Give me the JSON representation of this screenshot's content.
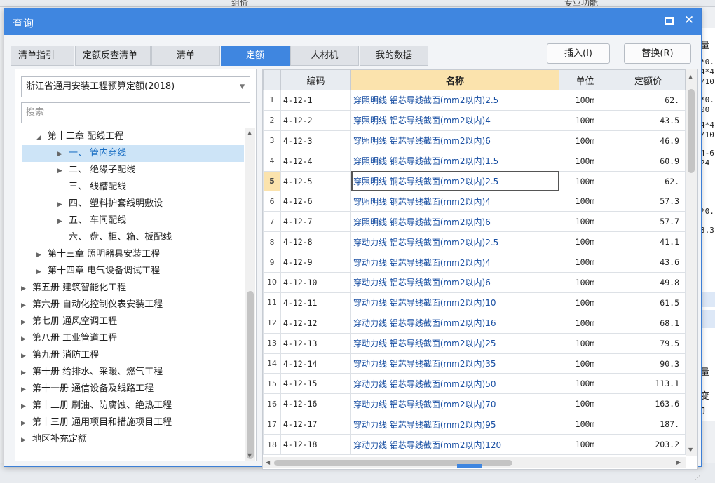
{
  "background": {
    "col_left": "组价",
    "col_right": "专业功能",
    "right_fragments": [
      "量",
      "*0.",
      "4*4",
      "/10",
      "*0.",
      "00",
      "4*4",
      "/10",
      "4-6",
      "24",
      "*0.",
      "3.3",
      "量",
      "变",
      "J"
    ]
  },
  "dialog": {
    "title": "查询",
    "tabs": [
      {
        "label": "清单指引"
      },
      {
        "label": "定额反查清单"
      },
      {
        "label": "清单"
      },
      {
        "label": "定额"
      },
      {
        "label": "人材机"
      },
      {
        "label": "我的数据"
      }
    ],
    "insert_button": "插入(I)",
    "replace_button": "替换(R)"
  },
  "left_panel": {
    "quota_select": "浙江省通用安装工程预算定额(2018)",
    "search_placeholder": "搜索",
    "tree": [
      {
        "label": "第十二章 配线工程"
      },
      {
        "label": "一、 管内穿线"
      },
      {
        "label": "二、 绝缘子配线"
      },
      {
        "label": "三、 线槽配线"
      },
      {
        "label": "四、 塑料护套线明敷设"
      },
      {
        "label": "五、 车间配线"
      },
      {
        "label": "六、 盘、柜、箱、板配线"
      },
      {
        "label": "第十三章 照明器具安装工程"
      },
      {
        "label": "第十四章 电气设备调试工程"
      },
      {
        "label": "第五册 建筑智能化工程"
      },
      {
        "label": "第六册 自动化控制仪表安装工程"
      },
      {
        "label": "第七册 通风空调工程"
      },
      {
        "label": "第八册 工业管道工程"
      },
      {
        "label": "第九册 消防工程"
      },
      {
        "label": "第十册 给排水、采暖、燃气工程"
      },
      {
        "label": "第十一册 通信设备及线路工程"
      },
      {
        "label": "第十二册 刷油、防腐蚀、绝热工程"
      },
      {
        "label": "第十三册 通用项目和措施项目工程"
      },
      {
        "label": "地区补充定额"
      }
    ]
  },
  "grid": {
    "headers": {
      "code": "编码",
      "name": "名称",
      "unit": "单位",
      "price": "定额价"
    },
    "rows": [
      {
        "num": "1",
        "code": "4-12-1",
        "name": "穿照明线 铝芯导线截面(mm2以内)2.5",
        "unit": "100m",
        "price": "62."
      },
      {
        "num": "2",
        "code": "4-12-2",
        "name": "穿照明线 铝芯导线截面(mm2以内)4",
        "unit": "100m",
        "price": "43.5"
      },
      {
        "num": "3",
        "code": "4-12-3",
        "name": "穿照明线 铝芯导线截面(mm2以内)6",
        "unit": "100m",
        "price": "46.9"
      },
      {
        "num": "4",
        "code": "4-12-4",
        "name": "穿照明线 铜芯导线截面(mm2以内)1.5",
        "unit": "100m",
        "price": "60.9"
      },
      {
        "num": "5",
        "code": "4-12-5",
        "name": "穿照明线 铜芯导线截面(mm2以内)2.5",
        "unit": "100m",
        "price": "62."
      },
      {
        "num": "6",
        "code": "4-12-6",
        "name": "穿照明线 铜芯导线截面(mm2以内)4",
        "unit": "100m",
        "price": "57.3"
      },
      {
        "num": "7",
        "code": "4-12-7",
        "name": "穿照明线 铜芯导线截面(mm2以内)6",
        "unit": "100m",
        "price": "57.7"
      },
      {
        "num": "8",
        "code": "4-12-8",
        "name": "穿动力线 铝芯导线截面(mm2以内)2.5",
        "unit": "100m",
        "price": "41.1"
      },
      {
        "num": "9",
        "code": "4-12-9",
        "name": "穿动力线 铝芯导线截面(mm2以内)4",
        "unit": "100m",
        "price": "43.6"
      },
      {
        "num": "10",
        "code": "4-12-10",
        "name": "穿动力线 铝芯导线截面(mm2以内)6",
        "unit": "100m",
        "price": "49.8"
      },
      {
        "num": "11",
        "code": "4-12-11",
        "name": "穿动力线 铝芯导线截面(mm2以内)10",
        "unit": "100m",
        "price": "61.5"
      },
      {
        "num": "12",
        "code": "4-12-12",
        "name": "穿动力线 铝芯导线截面(mm2以内)16",
        "unit": "100m",
        "price": "68.1"
      },
      {
        "num": "13",
        "code": "4-12-13",
        "name": "穿动力线 铝芯导线截面(mm2以内)25",
        "unit": "100m",
        "price": "79.5"
      },
      {
        "num": "14",
        "code": "4-12-14",
        "name": "穿动力线 铝芯导线截面(mm2以内)35",
        "unit": "100m",
        "price": "90.3"
      },
      {
        "num": "15",
        "code": "4-12-15",
        "name": "穿动力线 铝芯导线截面(mm2以内)50",
        "unit": "100m",
        "price": "113.1"
      },
      {
        "num": "16",
        "code": "4-12-16",
        "name": "穿动力线 铝芯导线截面(mm2以内)70",
        "unit": "100m",
        "price": "163.6"
      },
      {
        "num": "17",
        "code": "4-12-17",
        "name": "穿动力线 铝芯导线截面(mm2以内)95",
        "unit": "100m",
        "price": "187."
      },
      {
        "num": "18",
        "code": "4-12-18",
        "name": "穿动力线 铝芯导线截面(mm2以内)120",
        "unit": "100m",
        "price": "203.2"
      }
    ]
  }
}
